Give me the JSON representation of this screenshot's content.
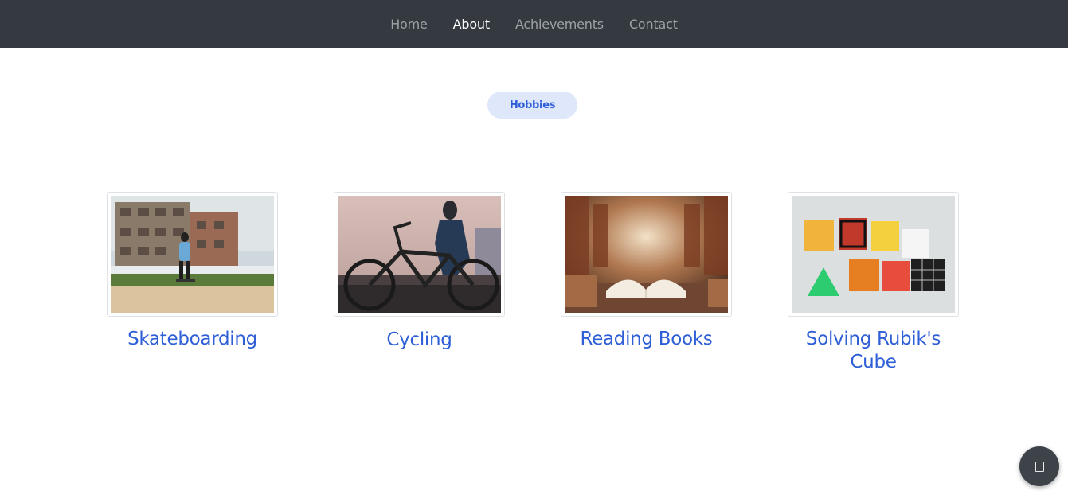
{
  "nav": {
    "items": [
      {
        "label": "Home"
      },
      {
        "label": "About"
      },
      {
        "label": "Achievements"
      },
      {
        "label": "Contact"
      }
    ]
  },
  "section": {
    "badge": "Hobbies"
  },
  "hobbies": [
    {
      "title": "Skateboarding"
    },
    {
      "title": "Cycling"
    },
    {
      "title": "Reading Books"
    },
    {
      "title": "Solving Rubik's Cube"
    }
  ],
  "colors": {
    "navbar_bg": "#343a40",
    "nav_active": "#ffffff",
    "nav_inactive": "#9ea2a7",
    "accent": "#2e5fd7",
    "badge_bg": "#dfe8fb",
    "fab_bg": "#3d4349"
  },
  "icons": {
    "fab": "square-icon"
  }
}
